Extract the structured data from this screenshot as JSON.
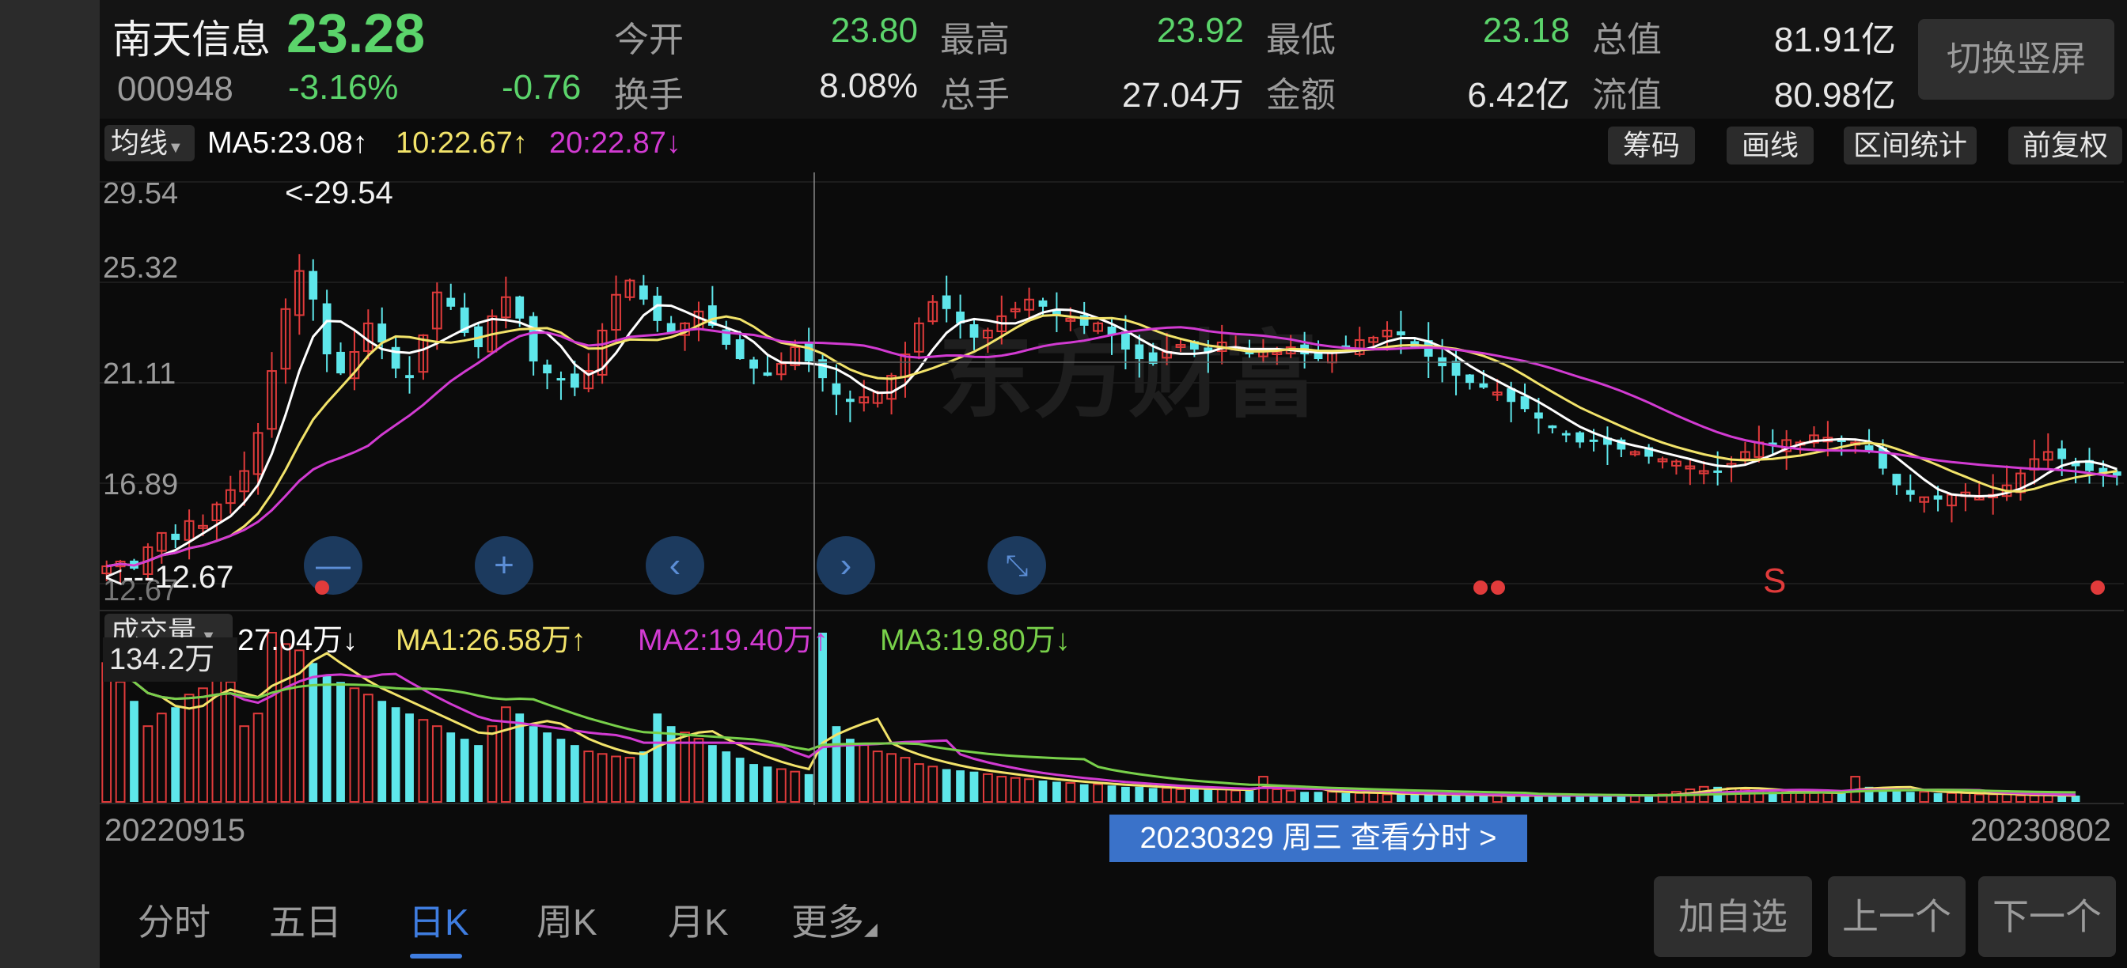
{
  "stock": {
    "name": "南天信息",
    "price": "23.28",
    "code": "000948",
    "change_pct": "-3.16%",
    "change": "-0.76",
    "switch_label": "切换竖屏"
  },
  "metrics": [
    {
      "label": "今开",
      "value": "23.80",
      "color": "#5bd46b"
    },
    {
      "label": "最高",
      "value": "23.92",
      "color": "#5bd46b"
    },
    {
      "label": "最低",
      "value": "23.18",
      "color": "#5bd46b"
    },
    {
      "label": "总值",
      "value": "81.91亿",
      "color": "#e6e6e6"
    },
    {
      "label": "换手",
      "value": "8.08%",
      "color": "#e6e6e6"
    },
    {
      "label": "总手",
      "value": "27.04万",
      "color": "#e6e6e6"
    },
    {
      "label": "金额",
      "value": "6.42亿",
      "color": "#e6e6e6"
    },
    {
      "label": "流值",
      "value": "80.98亿",
      "color": "#e6e6e6"
    }
  ],
  "ma_bar": {
    "tag": "均线",
    "ma5": "MA5:23.08↑",
    "ma10": "10:22.67↑",
    "ma20": "20:22.87↓",
    "buttons": [
      "筹码",
      "画线",
      "区间统计",
      "前复权"
    ]
  },
  "colors": {
    "up": "#e03b3b",
    "down": "#5ee6ea",
    "ma5": "#ffffff",
    "ma10": "#f2e36a",
    "ma20": "#d23bd2",
    "ma3": "#78d04a",
    "accent": "#3f7de0"
  },
  "overlay": {
    "high_marker": "<-29.54",
    "low_marker": "<---12.67",
    "signal_s": "S",
    "watermark": "东方财富"
  },
  "volume_bar": {
    "tag": "成交量",
    "current": "27.04万↓",
    "ma1": "MA1:26.58万↑",
    "ma2": "MA2:19.40万↑",
    "ma3": "MA3:19.80万↓",
    "max_label": "134.2万"
  },
  "dates": {
    "start": "20220915",
    "end": "20230802",
    "crosshair": "20230329 周三 查看分时 >"
  },
  "tabs": [
    "分时",
    "五日",
    "日K",
    "周K",
    "月K",
    "更多"
  ],
  "active_tab": "日K",
  "bottom_buttons": {
    "add": "加自选",
    "prev": "上一个",
    "next": "下一个"
  },
  "icons": [
    "zoom-out-icon",
    "zoom-in-icon",
    "chevron-left-icon",
    "chevron-right-icon",
    "collapse-icon"
  ],
  "chart_data": {
    "type": "candlestick",
    "y_ticks": [
      "29.54",
      "25.32",
      "21.11",
      "16.89",
      "12.67"
    ],
    "ylim": [
      12.67,
      29.54
    ],
    "high": 29.54,
    "low": 12.67,
    "x_start": "20220915",
    "x_end": "20230802",
    "selected_date": "20230329",
    "last_close": 23.28,
    "ma_values": {
      "MA5": 23.08,
      "MA10": 22.67,
      "MA20": 22.87
    },
    "closes": [
      13.4,
      13.6,
      13.3,
      14.2,
      14.8,
      14.5,
      15.3,
      15.1,
      16.0,
      16.6,
      17.4,
      19.0,
      21.6,
      24.2,
      25.8,
      24.6,
      22.3,
      21.5,
      22.4,
      23.6,
      22.8,
      21.7,
      21.3,
      23.1,
      24.9,
      24.3,
      23.2,
      22.6,
      23.9,
      24.7,
      23.8,
      22.0,
      21.5,
      21.2,
      20.9,
      21.6,
      23.3,
      24.8,
      25.4,
      24.6,
      23.7,
      23.2,
      23.6,
      24.1,
      23.5,
      22.7,
      22.1,
      21.7,
      21.4,
      21.9,
      22.6,
      22.0,
      21.3,
      20.6,
      20.3,
      20.5,
      20.7,
      21.4,
      22.3,
      23.6,
      24.5,
      24.2,
      23.6,
      23.0,
      23.3,
      23.9,
      24.2,
      24.6,
      24.3,
      23.9,
      23.8,
      23.5,
      23.6,
      23.1,
      22.5,
      22.1,
      21.9,
      22.4,
      22.7,
      22.5,
      22.4,
      22.8,
      22.6,
      22.3,
      22.5,
      22.4,
      22.6,
      22.3,
      22.1,
      22.4,
      22.6,
      22.9,
      23.0,
      23.3,
      23.1,
      22.6,
      22.2,
      21.8,
      21.4,
      21.1,
      20.9,
      20.7,
      20.3,
      20.0,
      19.6,
      19.2,
      18.9,
      18.6,
      18.7,
      18.5,
      18.3,
      18.2,
      18.0,
      17.9,
      17.8,
      17.6,
      17.4,
      17.4,
      17.7,
      18.2,
      18.6,
      18.5,
      18.7,
      18.6,
      18.9,
      18.8,
      18.7,
      18.6,
      18.2,
      17.5,
      16.8,
      16.4,
      16.3,
      16.2,
      16.4,
      16.5,
      16.3,
      16.4,
      16.8,
      17.3,
      17.9,
      18.2,
      17.9,
      17.6,
      17.4,
      17.3,
      17.2
    ],
    "volumes": [
      110,
      95,
      80,
      60,
      70,
      75,
      85,
      90,
      100,
      95,
      60,
      70,
      134,
      125,
      120,
      110,
      100,
      95,
      90,
      85,
      80,
      75,
      70,
      65,
      60,
      55,
      50,
      45,
      60,
      75,
      70,
      60,
      55,
      50,
      45,
      40,
      38,
      36,
      35,
      40,
      70,
      60,
      55,
      50,
      45,
      40,
      35,
      30,
      28,
      26,
      24,
      22,
      134,
      60,
      50,
      45,
      40,
      38,
      35,
      30,
      28,
      26,
      25,
      24,
      22,
      20,
      19,
      18,
      17,
      16,
      15,
      14,
      14,
      13,
      12,
      12,
      11,
      11,
      10,
      10,
      10,
      10,
      9,
      9,
      20,
      10,
      9,
      8,
      8,
      8,
      7,
      7,
      7,
      6,
      6,
      6,
      6,
      6,
      5,
      5,
      5,
      5,
      5,
      5,
      5,
      5,
      5,
      5,
      5,
      5,
      5,
      5,
      5,
      6,
      8,
      10,
      12,
      12,
      11,
      10,
      9,
      8,
      8,
      7,
      7,
      7,
      7,
      20,
      12,
      10,
      9,
      8,
      8,
      7,
      7,
      7,
      6,
      6,
      6,
      5,
      5,
      5,
      5,
      5
    ]
  }
}
